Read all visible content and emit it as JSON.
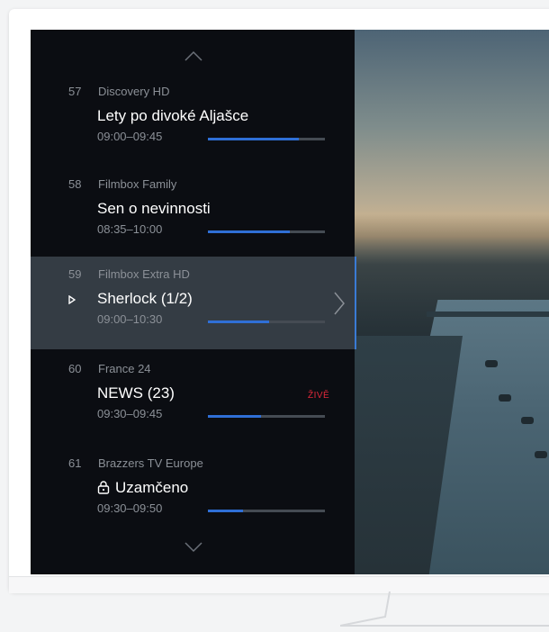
{
  "guide": {
    "channels": [
      {
        "number": "57",
        "name": "Discovery HD",
        "program": "Lety po divoké Aljašce",
        "time": "09:00–09:45",
        "progress": 0.78
      },
      {
        "number": "58",
        "name": "Filmbox Family",
        "program": "Sen o nevinnosti",
        "time": "08:35–10:00",
        "progress": 0.7
      },
      {
        "number": "59",
        "name": "Filmbox Extra HD",
        "program": "Sherlock (1/2)",
        "time": "09:00–10:30",
        "progress": 0.52
      },
      {
        "number": "60",
        "name": "France 24",
        "program": "NEWS (23)",
        "time": "09:30–09:45",
        "progress": 0.45,
        "badge": "ŽIVĚ"
      },
      {
        "number": "61",
        "name": "Brazzers TV Europe",
        "program": "Uzamčeno",
        "time": "09:30–09:50",
        "progress": 0.3
      }
    ],
    "selected_index": 2
  },
  "icons": {
    "up": "chevron-up-icon",
    "down": "chevron-down-icon",
    "play": "play-icon",
    "next": "chevron-right-icon",
    "lock": "lock-icon"
  },
  "colors": {
    "accent": "#2f6fd6",
    "live": "#e0283a",
    "selected_bg": "#343c44",
    "panel_bg": "#0b0d12"
  }
}
